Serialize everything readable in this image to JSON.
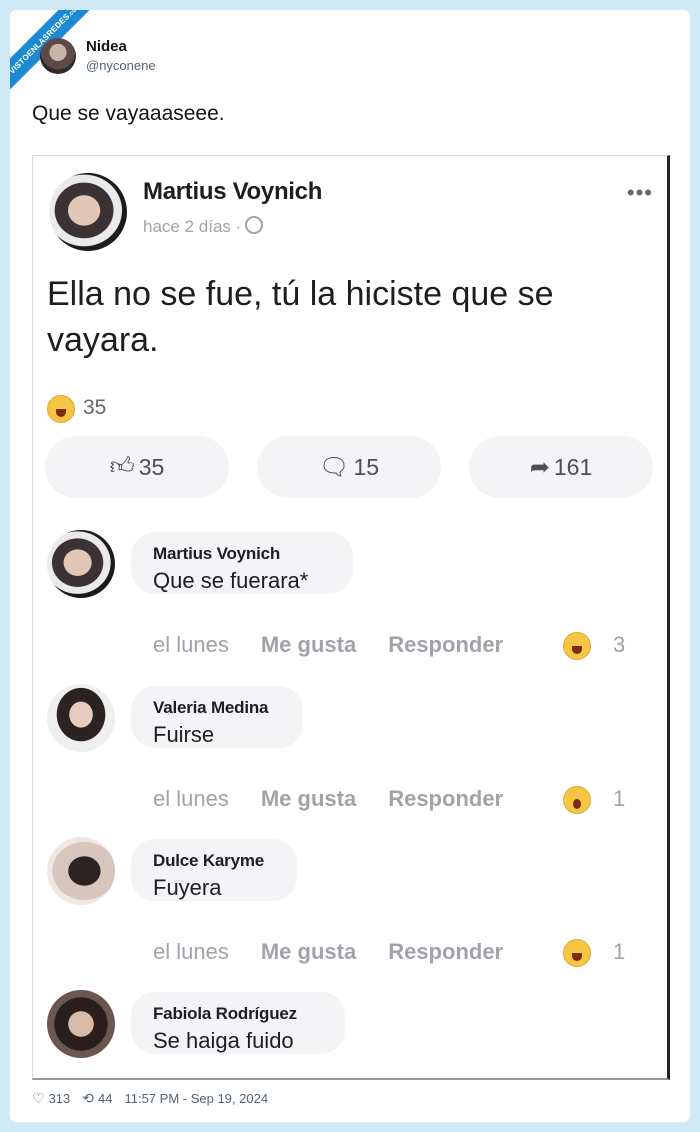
{
  "watermark": {
    "text": "VISTOENLASREDES",
    "suffix": ".com"
  },
  "tweet": {
    "author_name": "Nidea",
    "author_handle": "@nyconene",
    "text": "Que se vayaaaseee.",
    "likes": "313",
    "retweets": "44",
    "timestamp": "11:57 PM - Sep 19, 2024"
  },
  "post": {
    "author": "Martius Voynich",
    "time": "hace 2 días ·",
    "text": "Ella no se fue, tú la hiciste que se vayara.",
    "reaction_count": "35",
    "like_count": "35",
    "comment_count": "15",
    "share_count": "161"
  },
  "comments": [
    {
      "name": "Martius Voynich",
      "text": "Que se fuerara*",
      "time": "el lunes",
      "like": "Me gusta",
      "reply": "Responder",
      "reaction": "haha",
      "count": "3"
    },
    {
      "name": "Valeria Medina",
      "text": "Fuirse",
      "time": "el lunes",
      "like": "Me gusta",
      "reply": "Responder",
      "reaction": "wow",
      "count": "1"
    },
    {
      "name": "Dulce Karyme",
      "text": "Fuyera",
      "time": "el lunes",
      "like": "Me gusta",
      "reply": "Responder",
      "reaction": "haha",
      "count": "1"
    },
    {
      "name": "Fabiola Rodríguez",
      "text": "Se haiga fuido"
    }
  ],
  "colors": {
    "page_bg": "#cfe9f6",
    "ribbon": "#1c8ad1",
    "bubble": "#f4f3f6",
    "muted": "#a0a3a8"
  }
}
